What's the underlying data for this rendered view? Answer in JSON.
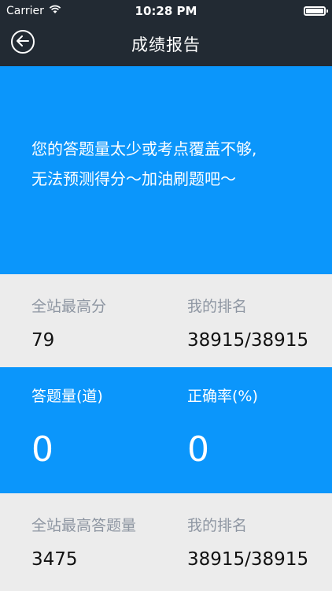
{
  "status_bar": {
    "carrier": "Carrier",
    "time": "10:28 PM"
  },
  "nav": {
    "title": "成绩报告"
  },
  "hero": {
    "line1": "您的答题量太少或考点覆盖不够,",
    "line2": "无法预测得分～加油刷题吧～"
  },
  "stats1": {
    "left_label": "全站最高分",
    "left_value": "79",
    "right_label": "我的排名",
    "right_value": "38915/38915"
  },
  "stats2": {
    "left_label": "答题量(道)",
    "left_value": "0",
    "right_label": "正确率(%)",
    "right_value": "0"
  },
  "stats3": {
    "left_label": "全站最高答题量",
    "left_value": "3475",
    "right_label": "我的排名",
    "right_value": "38915/38915"
  },
  "colors": {
    "nav_bg": "#222a33",
    "accent_blue": "#0b96fb",
    "gray_bg": "#ececec",
    "label_gray": "#8e96a2"
  },
  "icons": [
    "wifi-icon",
    "battery-icon",
    "back-arrow-icon"
  ]
}
